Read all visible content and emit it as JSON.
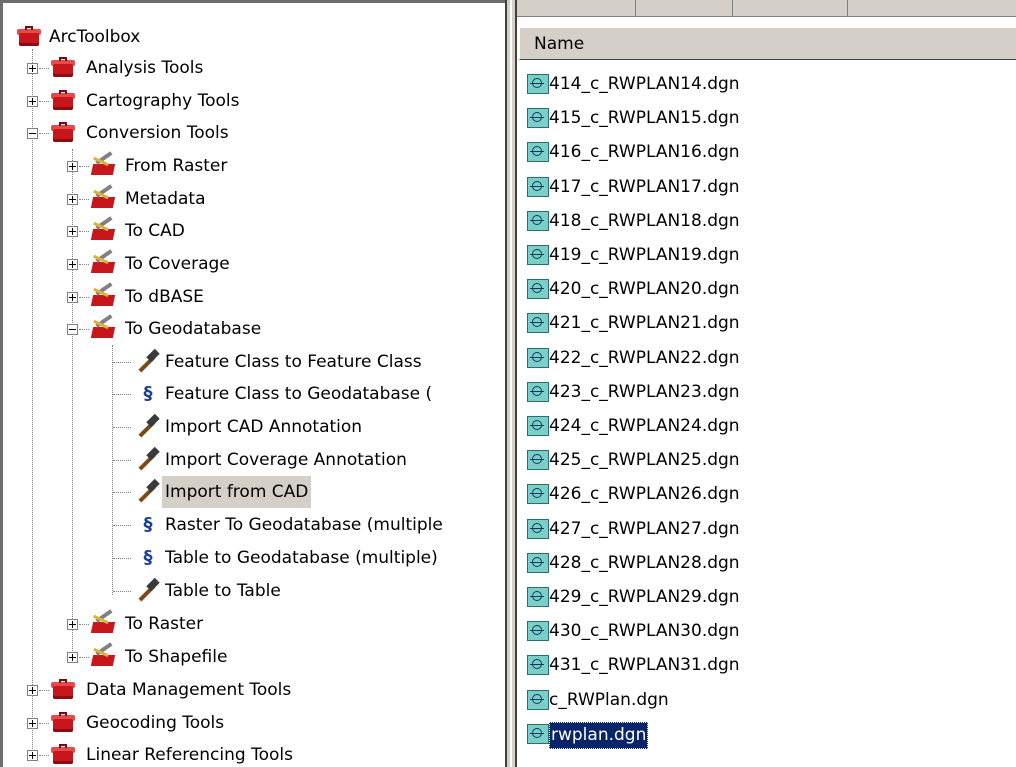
{
  "tree": {
    "root": "ArcToolbox",
    "toolboxes": [
      {
        "label": "Analysis Tools",
        "expanded": false
      },
      {
        "label": "Cartography Tools",
        "expanded": false
      },
      {
        "label": "Conversion Tools",
        "expanded": true
      },
      {
        "label": "Data Management Tools",
        "expanded": false
      },
      {
        "label": "Geocoding Tools",
        "expanded": false
      },
      {
        "label": "Linear Referencing Tools",
        "expanded": false
      }
    ],
    "toolsets": [
      {
        "label": "From Raster",
        "expanded": false
      },
      {
        "label": "Metadata",
        "expanded": false
      },
      {
        "label": "To CAD",
        "expanded": false
      },
      {
        "label": "To Coverage",
        "expanded": false
      },
      {
        "label": "To dBASE",
        "expanded": false
      },
      {
        "label": "To Geodatabase",
        "expanded": true
      },
      {
        "label": "To Raster",
        "expanded": false
      },
      {
        "label": "To Shapefile",
        "expanded": false
      }
    ],
    "tools": [
      {
        "label": "Feature Class to Feature Class",
        "icon": "hammer-icon"
      },
      {
        "label": "Feature Class to Geodatabase (",
        "icon": "script-icon"
      },
      {
        "label": "Import CAD Annotation",
        "icon": "hammer-icon"
      },
      {
        "label": "Import Coverage Annotation",
        "icon": "hammer-icon"
      },
      {
        "label": "Import from CAD",
        "icon": "hammer-icon",
        "selected": true
      },
      {
        "label": "Raster To Geodatabase (multiple",
        "icon": "script-icon"
      },
      {
        "label": "Table to Geodatabase (multiple)",
        "icon": "script-icon"
      },
      {
        "label": "Table to Table",
        "icon": "hammer-icon"
      }
    ]
  },
  "files": {
    "column_header": "Name",
    "items": [
      {
        "name": "414_c_RWPLAN14.dgn"
      },
      {
        "name": "415_c_RWPLAN15.dgn"
      },
      {
        "name": "416_c_RWPLAN16.dgn"
      },
      {
        "name": "417_c_RWPLAN17.dgn"
      },
      {
        "name": "418_c_RWPLAN18.dgn"
      },
      {
        "name": "419_c_RWPLAN19.dgn"
      },
      {
        "name": "420_c_RWPLAN20.dgn"
      },
      {
        "name": "421_c_RWPLAN21.dgn"
      },
      {
        "name": "422_c_RWPLAN22.dgn"
      },
      {
        "name": "423_c_RWPLAN23.dgn"
      },
      {
        "name": "424_c_RWPLAN24.dgn"
      },
      {
        "name": "425_c_RWPLAN25.dgn"
      },
      {
        "name": "426_c_RWPLAN26.dgn"
      },
      {
        "name": "427_c_RWPLAN27.dgn"
      },
      {
        "name": "428_c_RWPLAN28.dgn"
      },
      {
        "name": "429_c_RWPLAN29.dgn"
      },
      {
        "name": "430_c_RWPLAN30.dgn"
      },
      {
        "name": "431_c_RWPLAN31.dgn"
      },
      {
        "name": "c_RWPlan.dgn"
      },
      {
        "name": "rwplan.dgn",
        "selected": true
      }
    ]
  },
  "colors": {
    "selection": "#0a246a",
    "toolbox_red": "#c8161d",
    "panel_gray": "#d4d0c8"
  }
}
